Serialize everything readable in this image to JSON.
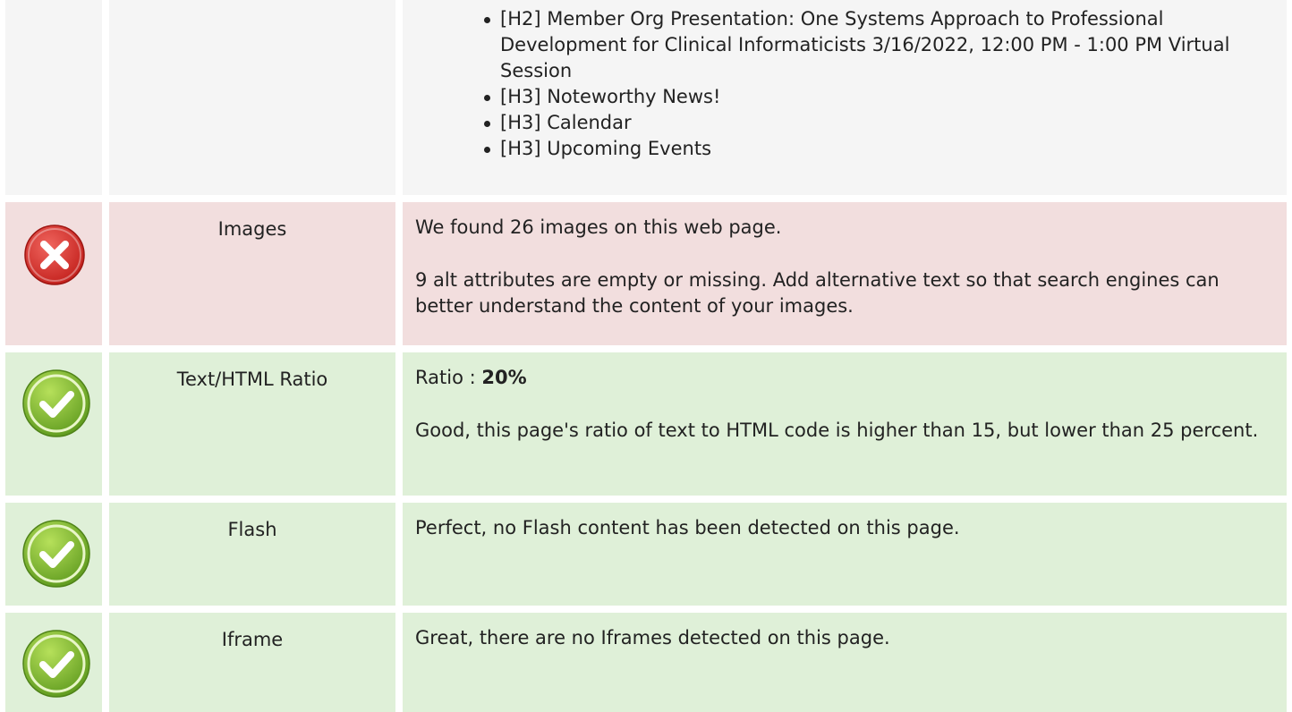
{
  "headings_row": {
    "items": [
      "[H2] Member Org Presentation: One Systems Approach to Professional Development for Clinical Informaticists 3/16/2022, 12:00 PM - 1:00 PM Virtual Session",
      "[H3] Noteworthy News!",
      "[H3] Calendar",
      "[H3] Upcoming Events"
    ]
  },
  "images_row": {
    "status": "error",
    "label": "Images",
    "line1": "We found 26 images on this web page.",
    "line2": "9 alt attributes are empty or missing. Add alternative text so that search engines can better understand the content of your images."
  },
  "ratio_row": {
    "status": "ok",
    "label": "Text/HTML Ratio",
    "ratio_prefix": "Ratio : ",
    "ratio_value": "20%",
    "line2": "Good, this page's ratio of text to HTML code is higher than 15, but lower than 25 percent."
  },
  "flash_row": {
    "status": "ok",
    "label": "Flash",
    "line1": "Perfect, no Flash content has been detected on this page."
  },
  "iframe_row": {
    "status": "ok",
    "label": "Iframe",
    "line1": "Great, there are no Iframes detected on this page."
  },
  "colors": {
    "neutral_bg": "#f5f5f5",
    "error_bg": "#f2dede",
    "ok_bg": "#dff0d8",
    "error_icon": "#d9302c",
    "ok_icon": "#7cb82f"
  },
  "icons": {
    "error": "error-x-icon",
    "ok": "check-icon"
  }
}
